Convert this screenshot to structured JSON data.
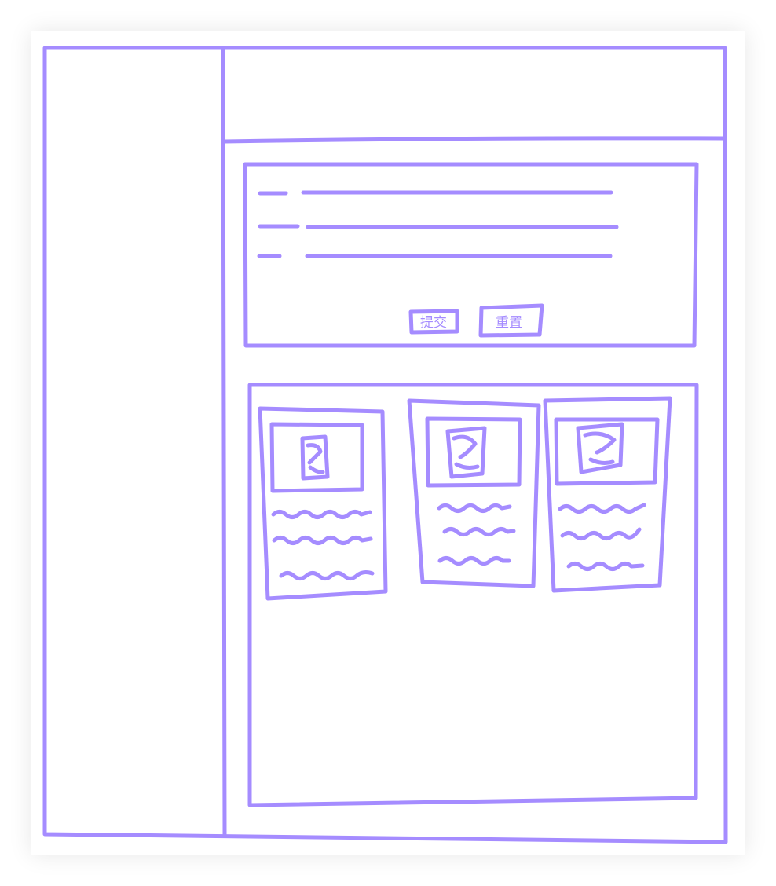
{
  "sketch": {
    "stroke_color": "#a58cff",
    "paper_color": "#ffffff"
  },
  "form": {
    "fields": [
      {
        "name": "field-1"
      },
      {
        "name": "field-2"
      },
      {
        "name": "field-3"
      }
    ],
    "submit_label": "提交",
    "reset_label": "重置"
  },
  "cards": [
    {
      "image_label": "图"
    },
    {
      "image_label": "图"
    },
    {
      "image_label": "图"
    }
  ]
}
